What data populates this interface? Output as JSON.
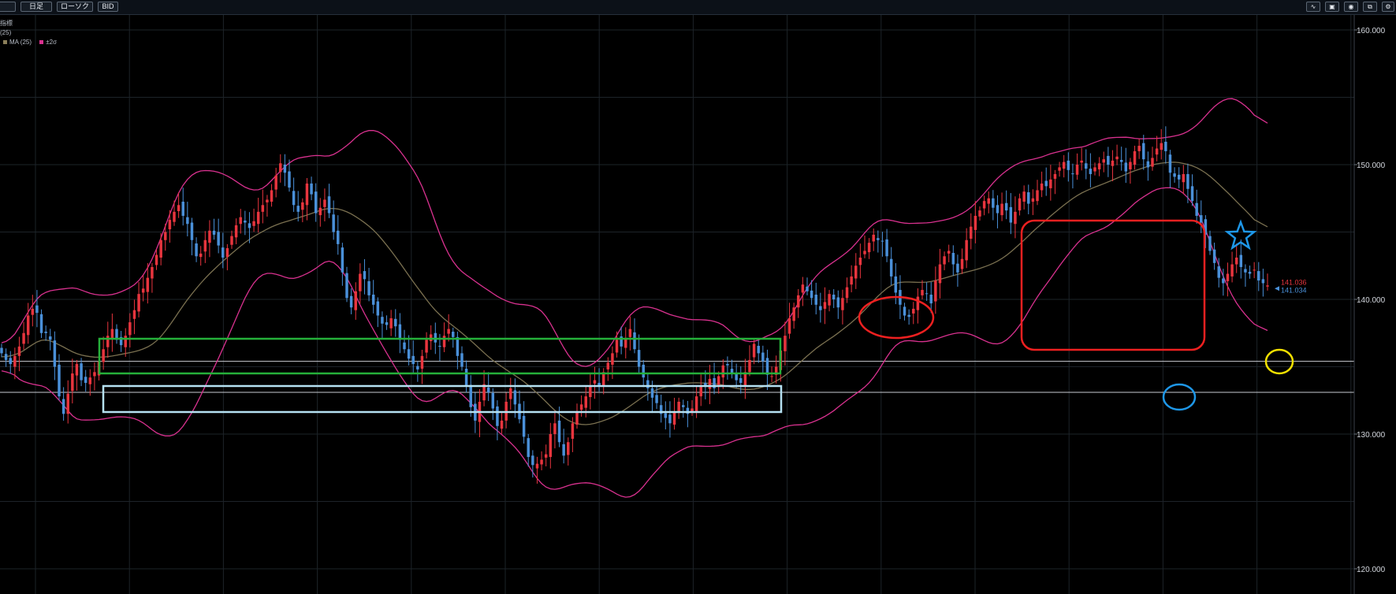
{
  "toolbar": {
    "buttons": [
      "日足",
      "ローソク",
      "BID"
    ],
    "icons": [
      "line-chart-icon",
      "save-icon",
      "camera-icon",
      "copy-icon",
      "settings-icon"
    ]
  },
  "legend": {
    "title": "指標",
    "items": [
      {
        "label": "(25)",
        "color": "#b9bfc9"
      },
      {
        "label": "MA (25)",
        "color": "#8b7f5a"
      },
      {
        "label": "±2σ",
        "color": "#d9318f"
      }
    ]
  },
  "chart_data": {
    "type": "candlestick",
    "yticks": [
      "160.000",
      "150.000",
      "140.000",
      "130.000",
      "120.000"
    ],
    "ylim": [
      118.3,
      161.8
    ],
    "grid": true,
    "last_prices": {
      "ask": "141.036",
      "bid": "141.034"
    },
    "horizontal_lines": [
      135.4,
      133.1
    ],
    "colors": {
      "up": "#e8353e",
      "down": "#4a90d9",
      "ma": "#7a7050",
      "band": "#d9318f"
    },
    "closes": [
      136.0,
      135.5,
      135.2,
      135.8,
      136.5,
      137.5,
      138.8,
      139.3,
      139.0,
      137.5,
      137.5,
      137.0,
      135.0,
      132.8,
      131.5,
      133.0,
      134.5,
      135.2,
      134.0,
      133.8,
      134.2,
      134.6,
      135.4,
      136.3,
      137.3,
      137.8,
      137.0,
      136.6,
      137.3,
      138.3,
      139.2,
      140.4,
      140.8,
      141.6,
      142.4,
      143.3,
      144.4,
      145.0,
      145.9,
      146.5,
      147.0,
      146.2,
      145.6,
      144.4,
      143.2,
      143.4,
      144.4,
      145.1,
      144.8,
      144.0,
      143.1,
      143.8,
      144.7,
      145.5,
      146.1,
      145.7,
      145.3,
      145.8,
      146.5,
      147.0,
      147.4,
      148.1,
      149.2,
      150.1,
      149.4,
      148.3,
      147.0,
      146.5,
      147.2,
      148.6,
      147.8,
      146.4,
      146.8,
      147.4,
      146.4,
      145.0,
      144.1,
      142.0,
      140.1,
      139.4,
      140.6,
      141.9,
      141.5,
      140.3,
      139.6,
      138.8,
      138.2,
      138.1,
      138.6,
      138.0,
      137.0,
      136.3,
      135.6,
      135.2,
      134.8,
      135.8,
      137.0,
      137.4,
      136.8,
      136.5,
      137.3,
      137.8,
      137.2,
      135.8,
      135.0,
      133.6,
      132.0,
      131.0,
      132.4,
      133.7,
      133.1,
      131.9,
      130.6,
      131.0,
      132.4,
      133.4,
      132.2,
      131.1,
      129.8,
      128.3,
      127.7,
      127.8,
      128.1,
      128.5,
      130.0,
      130.8,
      129.4,
      128.4,
      129.4,
      130.8,
      131.7,
      132.2,
      132.8,
      133.6,
      134.0,
      133.6,
      134.6,
      135.3,
      136.0,
      137.0,
      136.5,
      137.1,
      137.8,
      136.3,
      135.0,
      134.2,
      133.4,
      132.7,
      132.3,
      131.5,
      131.2,
      130.8,
      131.6,
      132.4,
      132.0,
      131.5,
      131.9,
      132.8,
      133.6,
      133.5,
      134.1,
      133.4,
      134.3,
      135.1,
      135.1,
      134.5,
      134.0,
      133.8,
      134.6,
      135.5,
      136.7,
      136.0,
      135.4,
      134.4,
      134.3,
      135.0,
      136.2,
      137.3,
      138.6,
      139.4,
      140.3,
      141.1,
      140.6,
      140.1,
      139.6,
      139.2,
      139.8,
      140.4,
      140.0,
      139.4,
      140.1,
      140.9,
      141.7,
      142.5,
      143.1,
      143.6,
      144.2,
      144.8,
      144.4,
      144.3,
      143.2,
      141.7,
      140.5,
      139.6,
      138.8,
      138.7,
      139.3,
      140.2,
      140.7,
      140.4,
      139.7,
      141.4,
      142.6,
      143.2,
      143.6,
      142.6,
      142.0,
      143.0,
      144.4,
      145.4,
      146.2,
      146.6,
      147.3,
      147.5,
      146.8,
      146.4,
      147.1,
      146.6,
      145.7,
      146.5,
      147.5,
      148.0,
      147.1,
      147.5,
      148.1,
      148.6,
      148.4,
      148.9,
      149.3,
      149.8,
      150.2,
      149.6,
      149.3,
      150.0,
      150.3,
      149.7,
      149.3,
      149.8,
      150.1,
      150.4,
      150.0,
      150.3,
      150.6,
      150.2,
      149.5,
      150.2,
      151.0,
      151.4,
      150.4,
      149.8,
      150.5,
      151.2,
      151.6,
      151.0,
      149.4,
      149.1,
      148.9,
      149.3,
      148.2,
      147.3,
      146.2,
      145.7,
      144.8,
      143.6,
      142.7,
      141.6,
      141.2,
      141.9,
      142.6,
      143.1,
      142.4,
      142.0,
      141.9,
      142.2,
      141.4,
      141.2,
      141.036
    ]
  },
  "annotations": {
    "colors": {
      "green": "#25b03a",
      "lightblue": "#b5e1f2",
      "red": "#ee2020",
      "blue": "#1e97e8",
      "yellow": "#f2e000"
    }
  }
}
